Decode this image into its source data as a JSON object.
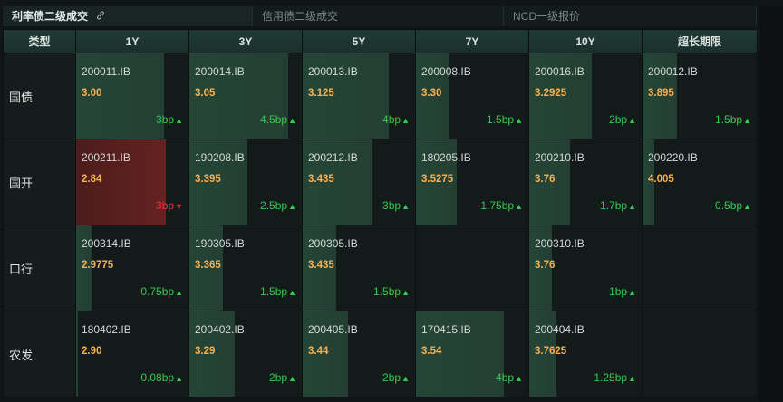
{
  "tabs": [
    {
      "label": "利率债二级成交",
      "link_icon": "link-icon"
    },
    {
      "label": "信用债二级成交"
    },
    {
      "label": "NCD一级报价"
    }
  ],
  "header": {
    "type_label": "类型",
    "columns": [
      "1Y",
      "3Y",
      "5Y",
      "7Y",
      "10Y",
      "超长期限"
    ]
  },
  "rows": [
    {
      "label": "国债",
      "cells": [
        {
          "code": "200011.IB",
          "yield": "3.00",
          "change": "3bp",
          "direction": "up",
          "bar": 0.78
        },
        {
          "code": "200014.IB",
          "yield": "3.05",
          "change": "4.5bp",
          "direction": "up",
          "bar": 0.88
        },
        {
          "code": "200013.IB",
          "yield": "3.125",
          "change": "4bp",
          "direction": "up",
          "bar": 0.77
        },
        {
          "code": "200008.IB",
          "yield": "3.30",
          "change": "1.5bp",
          "direction": "up",
          "bar": 0.3
        },
        {
          "code": "200016.IB",
          "yield": "3.2925",
          "change": "2bp",
          "direction": "up",
          "bar": 0.56
        },
        {
          "code": "200012.IB",
          "yield": "3.895",
          "change": "1.5bp",
          "direction": "up",
          "bar": 0.3
        }
      ]
    },
    {
      "label": "国开",
      "cells": [
        {
          "code": "200211.IB",
          "yield": "2.84",
          "change": "3bp",
          "direction": "down",
          "bar": 0.8
        },
        {
          "code": "190208.IB",
          "yield": "3.395",
          "change": "2.5bp",
          "direction": "up",
          "bar": 0.52
        },
        {
          "code": "200212.IB",
          "yield": "3.435",
          "change": "3bp",
          "direction": "up",
          "bar": 0.62
        },
        {
          "code": "180205.IB",
          "yield": "3.5275",
          "change": "1.75bp",
          "direction": "up",
          "bar": 0.36
        },
        {
          "code": "200210.IB",
          "yield": "3.76",
          "change": "1.7bp",
          "direction": "up",
          "bar": 0.36
        },
        {
          "code": "200220.IB",
          "yield": "4.005",
          "change": "0.5bp",
          "direction": "up",
          "bar": 0.1
        }
      ]
    },
    {
      "label": "口行",
      "cells": [
        {
          "code": "200314.IB",
          "yield": "2.9775",
          "change": "0.75bp",
          "direction": "up",
          "bar": 0.14
        },
        {
          "code": "190305.IB",
          "yield": "3.365",
          "change": "1.5bp",
          "direction": "up",
          "bar": 0.3
        },
        {
          "code": "200305.IB",
          "yield": "3.435",
          "change": "1.5bp",
          "direction": "up",
          "bar": 0.3
        },
        null,
        {
          "code": "200310.IB",
          "yield": "3.76",
          "change": "1bp",
          "direction": "up",
          "bar": 0.2
        },
        null
      ]
    },
    {
      "label": "农发",
      "cells": [
        {
          "code": "180402.IB",
          "yield": "2.90",
          "change": "0.08bp",
          "direction": "up",
          "bar": 0.02
        },
        {
          "code": "200402.IB",
          "yield": "3.29",
          "change": "2bp",
          "direction": "up",
          "bar": 0.4
        },
        {
          "code": "200405.IB",
          "yield": "3.44",
          "change": "2bp",
          "direction": "up",
          "bar": 0.4
        },
        {
          "code": "170415.IB",
          "yield": "3.54",
          "change": "4bp",
          "direction": "up",
          "bar": 0.78
        },
        {
          "code": "200404.IB",
          "yield": "3.7625",
          "change": "1.25bp",
          "direction": "up",
          "bar": 0.24
        },
        null
      ]
    }
  ],
  "colors": {
    "up": "#34c84f",
    "down": "#e8343a",
    "yield": "#f1b35a",
    "header_bg": "#1f3a34"
  }
}
